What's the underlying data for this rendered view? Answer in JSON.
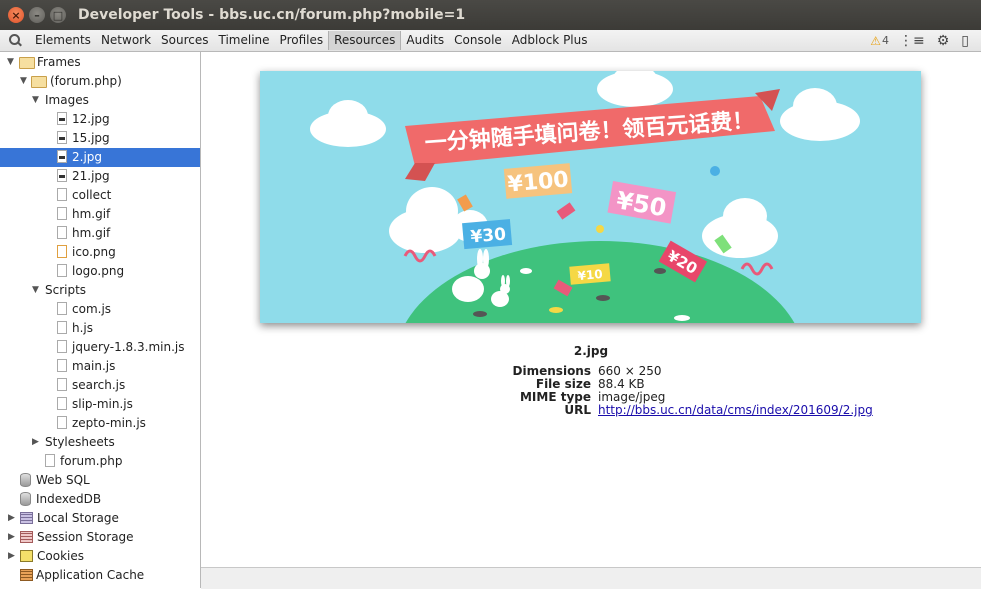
{
  "window": {
    "title": "Developer Tools - bbs.uc.cn/forum.php?mobile=1"
  },
  "toolbar": {
    "tabs": [
      "Elements",
      "Network",
      "Sources",
      "Timeline",
      "Profiles",
      "Resources",
      "Audits",
      "Console",
      "Adblock Plus"
    ],
    "active_tab": "Resources",
    "warning_count": "4"
  },
  "sidebar": {
    "frames": "Frames",
    "frame": "(forum.php)",
    "images": "Images",
    "image_files": [
      "12.jpg",
      "15.jpg",
      "2.jpg",
      "21.jpg",
      "collect",
      "hm.gif",
      "hm.gif",
      "ico.png",
      "logo.png"
    ],
    "selected": "2.jpg",
    "scripts": "Scripts",
    "script_files": [
      "com.js",
      "h.js",
      "jquery-1.8.3.min.js",
      "main.js",
      "search.js",
      "slip-min.js",
      "zepto-min.js"
    ],
    "stylesheets": "Stylesheets",
    "document": "forum.php",
    "web_sql": "Web SQL",
    "indexeddb": "IndexedDB",
    "local_storage": "Local Storage",
    "session_storage": "Session Storage",
    "cookies": "Cookies",
    "app_cache": "Application Cache"
  },
  "preview": {
    "banner_text": "一分钟随手填问卷！领百元话费！",
    "tags": [
      "¥100",
      "¥50",
      "¥30",
      "¥20",
      "¥10"
    ]
  },
  "details": {
    "name": "2.jpg",
    "dimensions_label": "Dimensions",
    "dimensions": "660 × 250",
    "size_label": "File size",
    "size": "88.4 KB",
    "mime_label": "MIME type",
    "mime": "image/jpeg",
    "url_label": "URL",
    "url": "http://bbs.uc.cn/data/cms/index/201609/2.jpg"
  }
}
